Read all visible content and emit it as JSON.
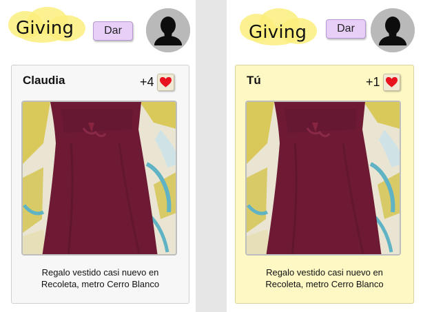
{
  "app": {
    "logo_text": "Giving",
    "give_button": "Dar"
  },
  "feed": {
    "cards": [
      {
        "user": "Claudia",
        "likes": "+4",
        "description": "Regalo vestido casi nuevo en Recoleta, metro Cerro Blanco",
        "photo_icon": "dress-photo"
      },
      {
        "user": "Tú",
        "likes": "+1",
        "description": "Regalo vestido casi nuevo en Recoleta, metro Cerro Blanco",
        "photo_icon": "dress-photo"
      }
    ]
  },
  "colors": {
    "logo_highlight": "#fbee7c",
    "give_button_bg": "#e7cff7",
    "own_card_bg": "#fdf8c4",
    "other_card_bg": "#f7f7f7",
    "heart": "#e8121e",
    "dress": "#6e1a35"
  },
  "icons": {
    "avatar": "user-silhouette-icon",
    "like": "heart-icon"
  }
}
